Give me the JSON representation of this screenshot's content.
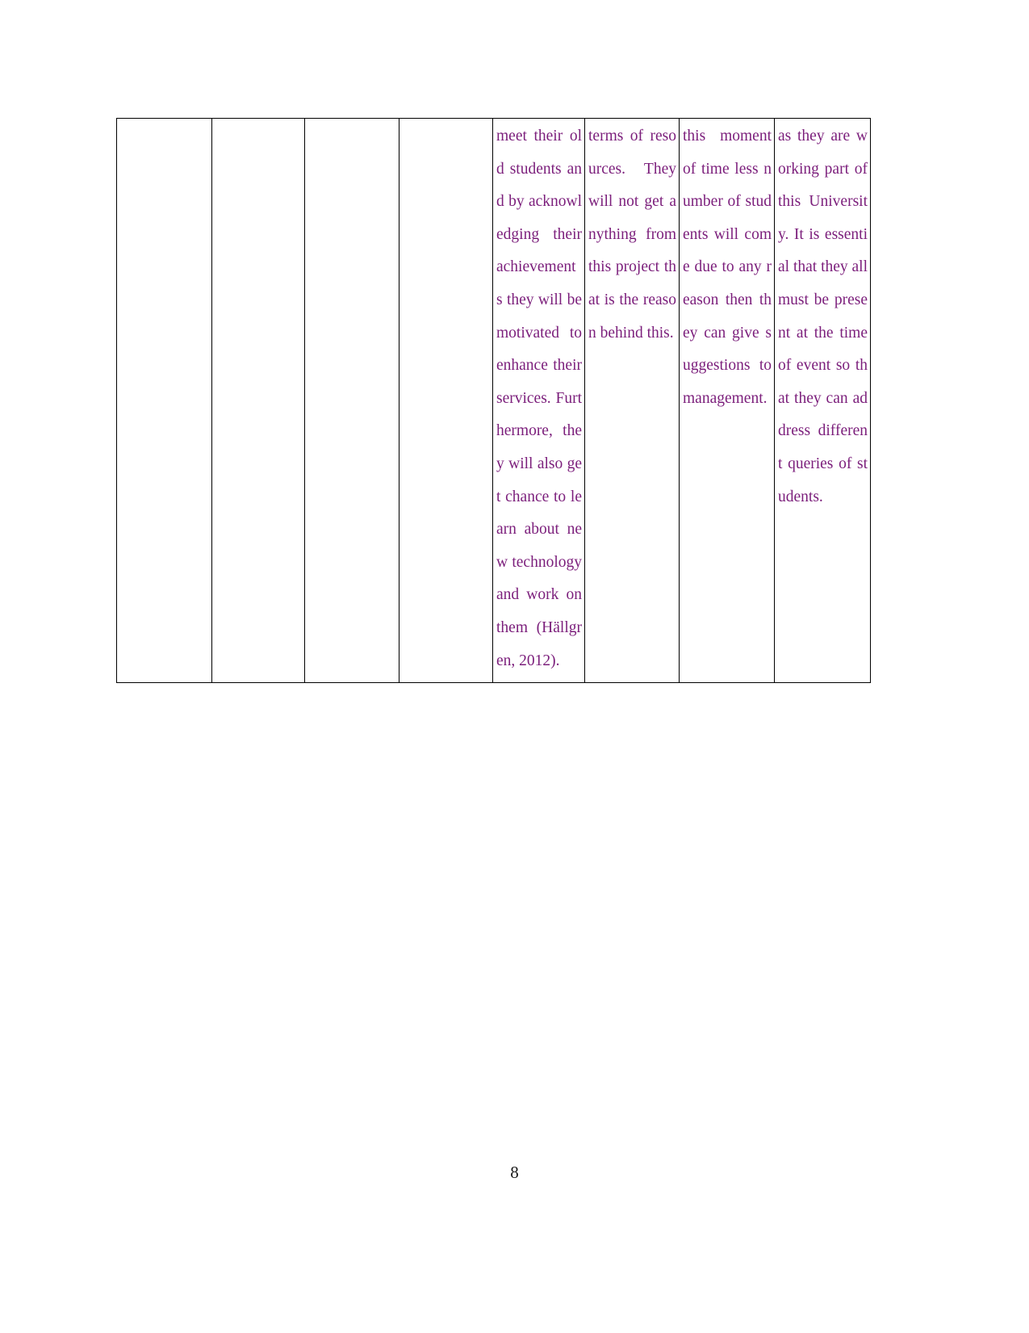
{
  "document": {
    "page_number": "8",
    "text_color": "#7B1E7B",
    "border_color": "#000000",
    "background_color": "#FFFFFF"
  },
  "table": {
    "columns": 8,
    "rows": 1,
    "cells": [
      {
        "id": "col1",
        "text": ""
      },
      {
        "id": "col2",
        "text": ""
      },
      {
        "id": "col3",
        "text": ""
      },
      {
        "id": "col4",
        "text": ""
      },
      {
        "id": "col5",
        "text": "meet their old students and by acknowledging their achievements they will be motivated to enhance their services. Furthermore, they will also get chance to learn about new technology and work on them (Hällgren, 2012)."
      },
      {
        "id": "col6",
        "text": "terms of resources. They will not get anything from this project that is the reason behind this."
      },
      {
        "id": "col7",
        "text": "this moment of time less number of students will come due to any reason then they can give suggestions to management."
      },
      {
        "id": "col8",
        "text": "as they are working part of this University. It is essential that they all must be present at the time of event so that they can address different queries of students."
      }
    ]
  }
}
